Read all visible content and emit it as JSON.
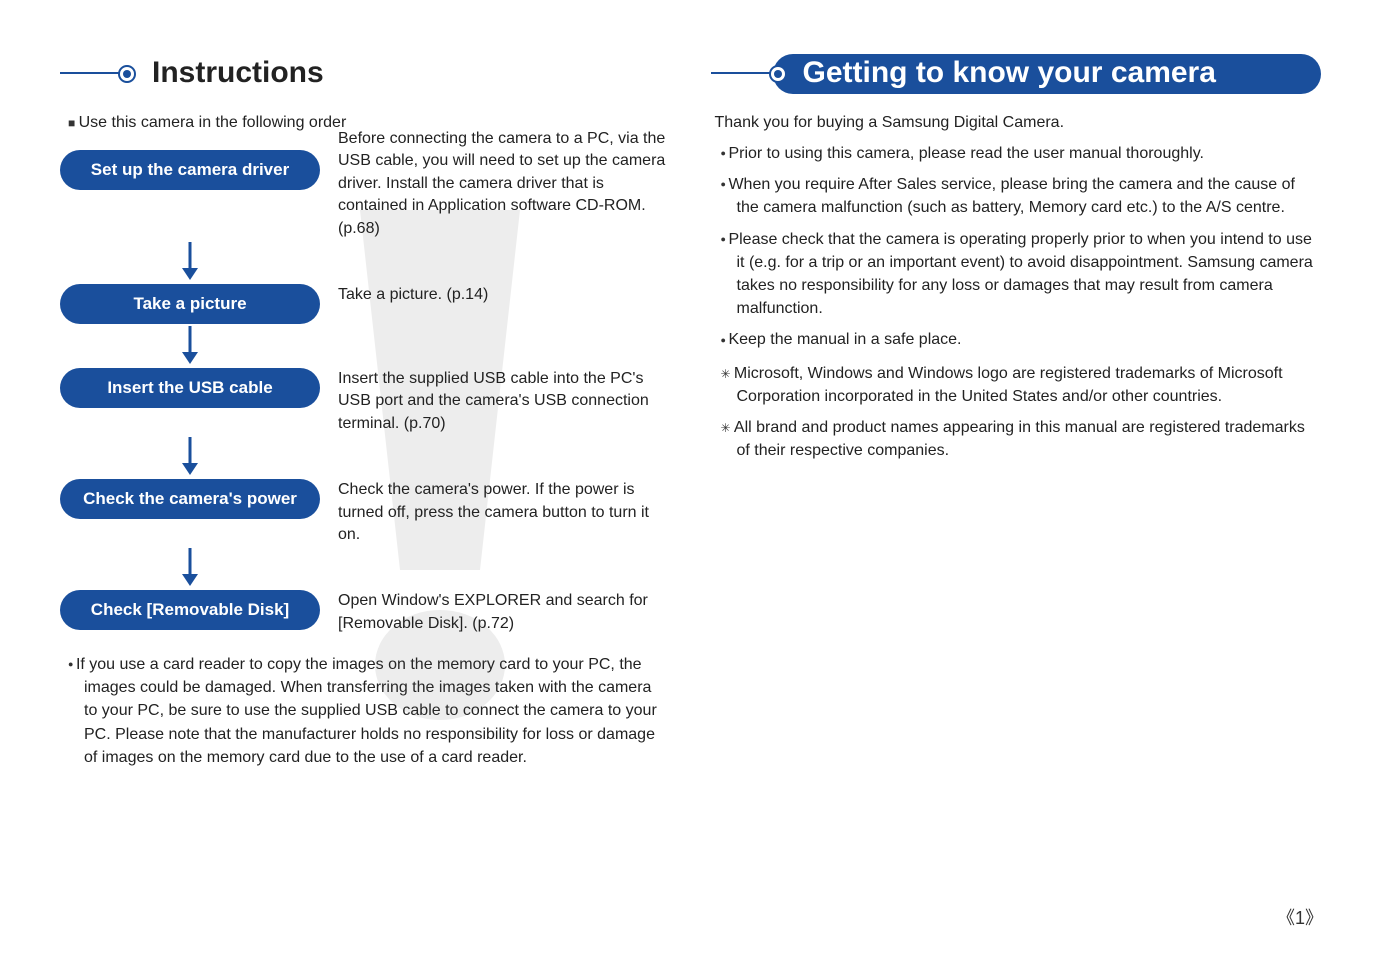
{
  "left": {
    "title": "Instructions",
    "intro": "Use this camera in the following order",
    "steps": [
      {
        "label": "Set up the camera driver",
        "desc": "Before connecting the camera to a PC, via the USB cable, you will need to set up the camera driver. Install the camera driver that is contained in Application software CD-ROM. (p.68)"
      },
      {
        "label": "Take a picture",
        "desc": "Take a picture.  (p.14)"
      },
      {
        "label": "Insert the USB cable",
        "desc": "Insert the supplied USB cable into the PC's USB port and the camera's USB connection terminal. (p.70)"
      },
      {
        "label": "Check the camera's power",
        "desc": "Check the camera's power. If the power is turned off, press the camera button to turn it on."
      },
      {
        "label": "Check [Removable Disk]",
        "desc": "Open Window's EXPLORER and search for [Removable Disk]. (p.72)"
      }
    ],
    "footnote": "If you use a card reader to copy the images on the memory card to your PC, the images could be damaged. When transferring the images taken with the camera to your PC, be sure to use the supplied USB cable to connect the camera to your PC. Please note that the manufacturer holds no responsibility for loss or damage of images on the memory card due to the use of a card reader."
  },
  "right": {
    "title": "Getting to know your camera",
    "intro": "Thank you for buying a Samsung Digital Camera.",
    "bullets": [
      "Prior to using this camera, please read the user manual thoroughly.",
      "When you require After Sales service, please bring the camera and the cause of the camera malfunction (such as battery, Memory card etc.) to the A/S centre.",
      "Please check that the camera is operating properly prior to when you intend to use it (e.g. for a trip or an important event) to avoid disappointment. Samsung camera takes no responsibility for any loss or damages that may result from camera malfunction.",
      "Keep the manual in a safe place."
    ],
    "notes": [
      "Microsoft, Windows and Windows logo are registered trademarks of Microsoft Corporation incorporated in the United States and/or other countries.",
      "All brand and product names appearing in this manual are registered trademarks of their respective companies."
    ]
  },
  "page_number": "1"
}
